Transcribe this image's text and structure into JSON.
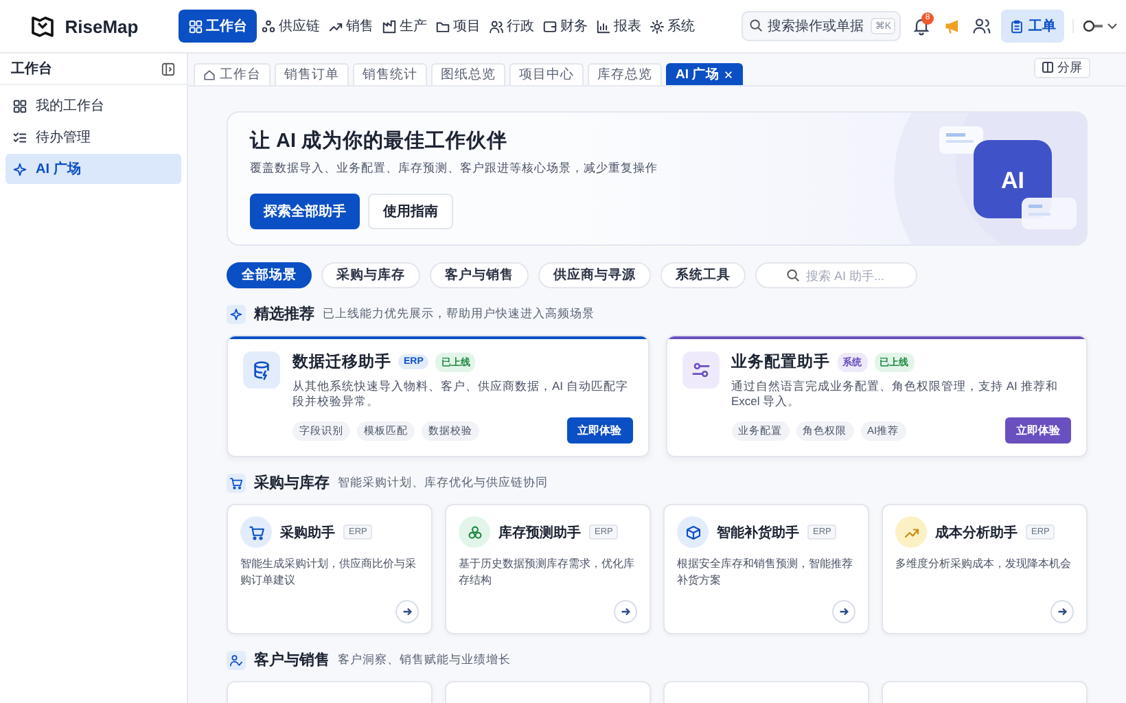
{
  "header": {
    "logo": "RiseMap",
    "nav": [
      {
        "label": "工作台",
        "kind": "grid",
        "selected": true
      },
      {
        "label": "供应链",
        "kind": "network",
        "selected": false
      },
      {
        "label": "销售",
        "kind": "trend",
        "selected": false
      },
      {
        "label": "生产",
        "kind": "factory",
        "selected": false
      },
      {
        "label": "项目",
        "kind": "folder",
        "selected": false
      },
      {
        "label": "行政",
        "kind": "people",
        "selected": false
      },
      {
        "label": "财务",
        "kind": "wallet",
        "selected": false
      },
      {
        "label": "报表",
        "kind": "bars",
        "selected": false
      },
      {
        "label": "系统",
        "kind": "gear",
        "selected": false
      }
    ],
    "search": {
      "placeholder": "搜索操作或单据",
      "shortcut": "⌘K"
    },
    "notification_count": "8",
    "work_order": "工单"
  },
  "sidebar": {
    "title": "工作台",
    "items": [
      {
        "label": "我的工作台",
        "kind": "grid",
        "selected": false
      },
      {
        "label": "待办管理",
        "kind": "list",
        "selected": false
      },
      {
        "label": "AI 广场",
        "kind": "sparkle",
        "selected": true
      }
    ]
  },
  "tabs": [
    {
      "label": "工作台",
      "kind": "home",
      "selected": false
    },
    {
      "label": "销售订单",
      "kind": "page",
      "selected": false
    },
    {
      "label": "销售统计",
      "kind": "page",
      "selected": false
    },
    {
      "label": "图纸总览",
      "kind": "page",
      "selected": false
    },
    {
      "label": "项目中心",
      "kind": "page",
      "selected": false
    },
    {
      "label": "库存总览",
      "kind": "page",
      "selected": false
    },
    {
      "label": "AI 广场",
      "kind": "closable",
      "selected": true
    }
  ],
  "split_button": "分屏",
  "hero": {
    "title": "让 AI 成为你的最佳工作伙伴",
    "subtitle": "覆盖数据导入、业务配置、库存预测、客户跟进等核心场景，减少重复操作",
    "primary_button": "探索全部助手",
    "secondary_button": "使用指南",
    "badge": "AI"
  },
  "filters": {
    "chips": [
      {
        "label": "全部场景",
        "selected": true
      },
      {
        "label": "采购与库存",
        "selected": false
      },
      {
        "label": "客户与销售",
        "selected": false
      },
      {
        "label": "供应商与寻源",
        "selected": false
      },
      {
        "label": "系统工具",
        "selected": false
      }
    ],
    "search_placeholder": "搜索 AI 助手..."
  },
  "featured": {
    "title": "精选推荐",
    "description": "已上线能力优先展示，帮助用户快速进入高频场景",
    "cards": [
      {
        "title": "数据迁移助手",
        "kind": "database",
        "color": "#0b4fc4",
        "tags": [
          {
            "text": "ERP",
            "kind": "erp"
          },
          {
            "text": "已上线",
            "kind": "live"
          }
        ],
        "description": "从其他系统快速导入物料、客户、供应商数据，AI 自动匹配字段并校验异常。",
        "chips": [
          "字段识别",
          "模板匹配",
          "数据校验"
        ],
        "button": "立即体验"
      },
      {
        "title": "业务配置助手",
        "kind": "sliders",
        "color": "#6a4fc0",
        "tags": [
          {
            "text": "系统",
            "kind": "system"
          },
          {
            "text": "已上线",
            "kind": "live"
          }
        ],
        "description": "通过自然语言完成业务配置、角色权限管理，支持 AI 推荐和 Excel 导入。",
        "chips": [
          "业务配置",
          "角色权限",
          "AI推荐"
        ],
        "button": "立即体验"
      }
    ]
  },
  "sections": [
    {
      "title": "采购与库存",
      "kind": "cart",
      "description": "智能采购计划、库存优化与供应链协同",
      "cards": [
        {
          "kind": "cart",
          "title": "采购助手",
          "tag": "ERP",
          "description": "智能生成采购计划，供应商比价与采购订单建议"
        },
        {
          "kind": "cubes",
          "title": "库存预测助手",
          "tag": "ERP",
          "description": "基于历史数据预测库存需求，优化库存结构"
        },
        {
          "kind": "box",
          "title": "智能补货助手",
          "tag": "ERP",
          "description": "根据安全库存和销售预测，智能推荐补货方案"
        },
        {
          "kind": "trend",
          "title": "成本分析助手",
          "tag": "ERP",
          "description": "多维度分析采购成本，发现降本机会"
        }
      ]
    },
    {
      "title": "客户与销售",
      "kind": "usercheck",
      "description": "客户洞察、销售赋能与业绩增长",
      "cards": [
        {
          "kind": "empty"
        },
        {
          "kind": "empty"
        },
        {
          "kind": "empty"
        },
        {
          "kind": "empty"
        }
      ]
    }
  ]
}
